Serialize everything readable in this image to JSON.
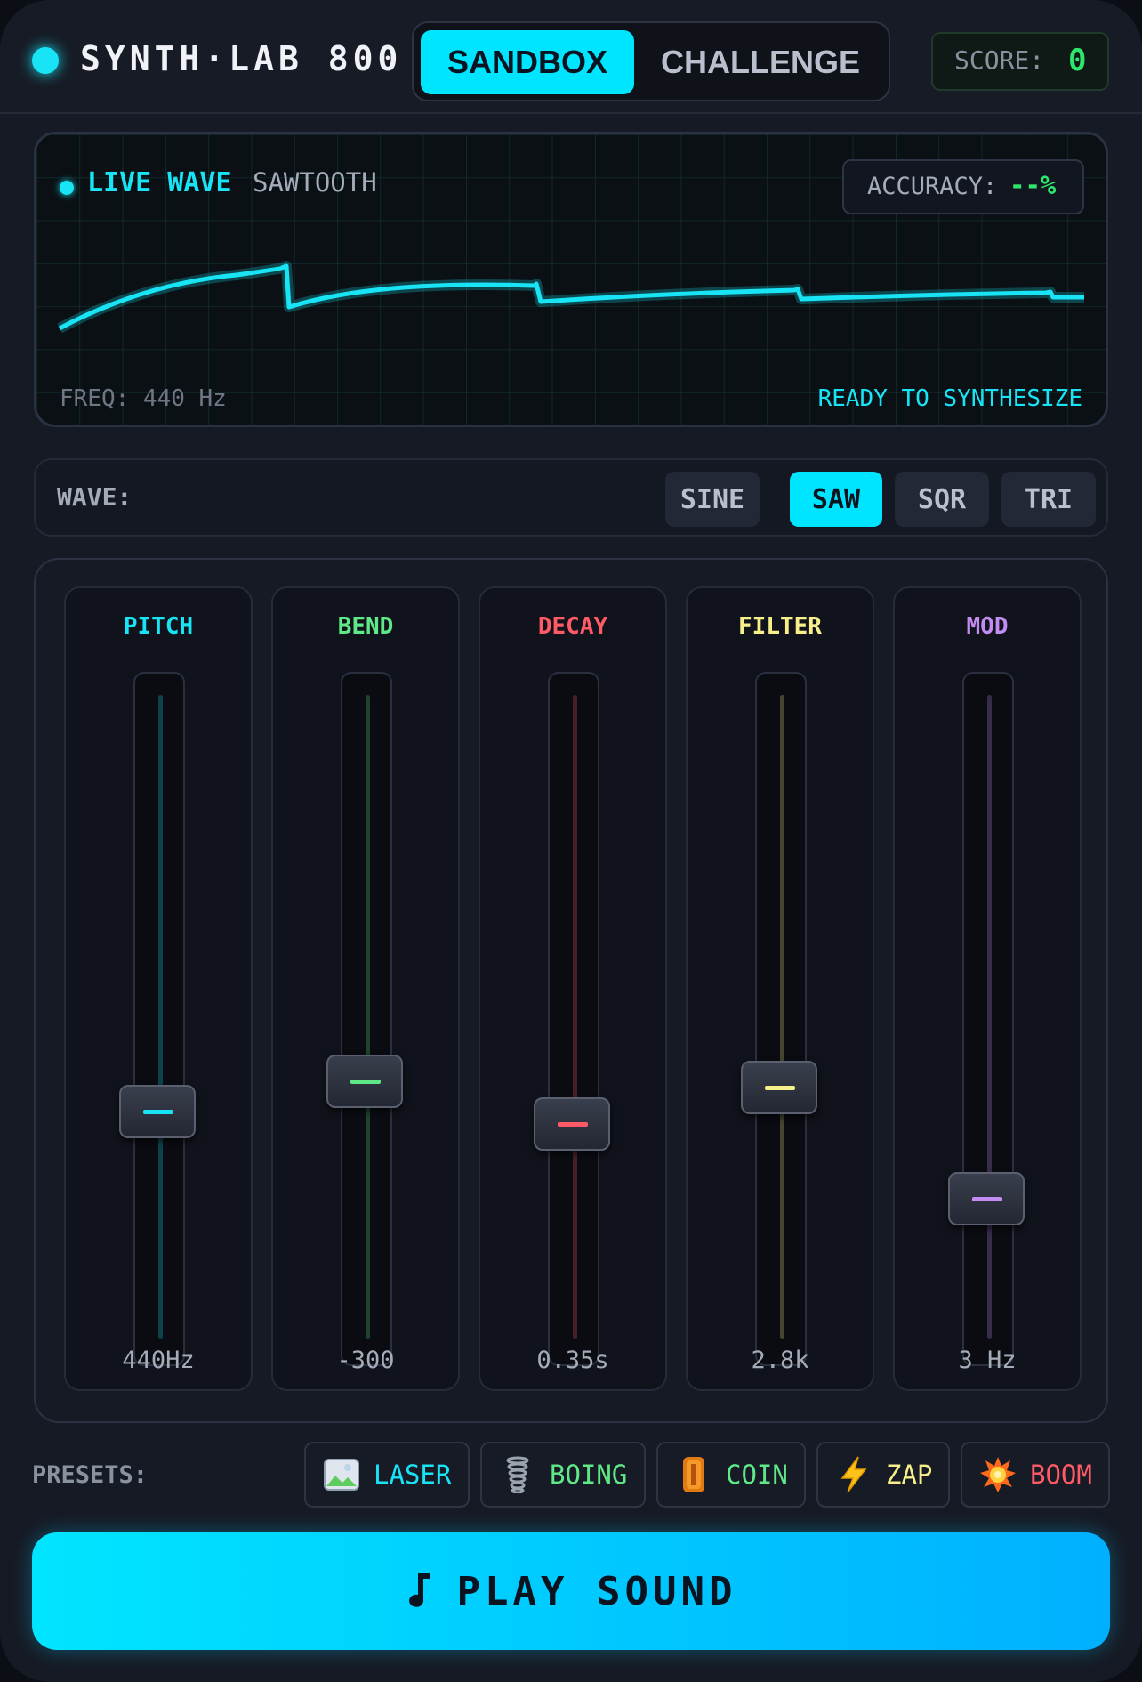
{
  "header": {
    "title": "SYNTH·LAB 800",
    "modes": [
      "SANDBOX",
      "CHALLENGE"
    ],
    "active_mode": "SANDBOX",
    "score_label": "SCORE:",
    "score_value": "0"
  },
  "scope": {
    "live_label": "LIVE WAVE",
    "wave_name": "SAWTOOTH",
    "accuracy_label": "ACCURACY:",
    "accuracy_value": "--%",
    "freq_text": "FREQ: 440 Hz",
    "status_text": "READY TO SYNTHESIZE"
  },
  "wave_selector": {
    "label": "WAVE:",
    "options": [
      "SINE",
      "SAW",
      "SQR",
      "TRI"
    ],
    "active": "SAW"
  },
  "sliders": [
    {
      "name": "PITCH",
      "value": "440Hz",
      "level": 0.35,
      "color": "#18e4f5"
    },
    {
      "name": "BEND",
      "value": "-300",
      "level": 0.4,
      "color": "#5fe887"
    },
    {
      "name": "DECAY",
      "value": "0.35s",
      "level": 0.33,
      "color": "#ff5a66"
    },
    {
      "name": "FILTER",
      "value": "2.8k",
      "level": 0.39,
      "color": "#f7f08a"
    },
    {
      "name": "MOD",
      "value": "3 Hz",
      "level": 0.21,
      "color": "#c38cf2"
    }
  ],
  "presets": {
    "label": "PRESETS:",
    "items": [
      {
        "label": "LASER",
        "icon": "laser-icon",
        "color": "#18e4f5"
      },
      {
        "label": "BOING",
        "icon": "spring-icon",
        "color": "#5fe887"
      },
      {
        "label": "COIN",
        "icon": "coin-icon",
        "color": "#5fe887"
      },
      {
        "label": "ZAP",
        "icon": "lightning-icon",
        "color": "#f7f08a"
      },
      {
        "label": "BOOM",
        "icon": "explosion-icon",
        "color": "#ff5a66"
      }
    ]
  },
  "play_button": {
    "icon": "music-note-icon",
    "label": "PLAY SOUND"
  }
}
